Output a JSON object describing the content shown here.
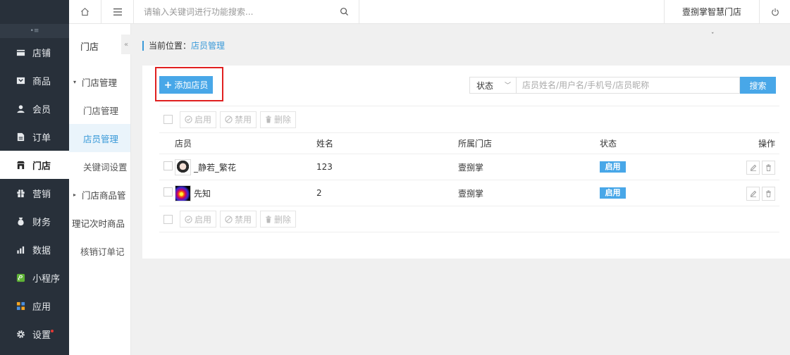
{
  "sidebar": {
    "toggle": "•≡",
    "items": [
      {
        "label": "店铺",
        "icon": "store-icon"
      },
      {
        "label": "商品",
        "icon": "goods-icon"
      },
      {
        "label": "会员",
        "icon": "member-icon"
      },
      {
        "label": "订单",
        "icon": "order-icon"
      },
      {
        "label": "门店",
        "icon": "shop-icon",
        "active": true
      },
      {
        "label": "营销",
        "icon": "gift-icon"
      },
      {
        "label": "财务",
        "icon": "finance-icon"
      },
      {
        "label": "数据",
        "icon": "data-icon"
      },
      {
        "label": "小程序",
        "icon": "miniapp-icon"
      },
      {
        "label": "应用",
        "icon": "apps-icon"
      },
      {
        "label": "设置",
        "icon": "settings-icon"
      }
    ]
  },
  "topbar": {
    "search_placeholder": "请输入关键词进行功能搜索...",
    "store_name": "壹捌掌智慧门店"
  },
  "submenu": {
    "title": "门店",
    "collapse": "«",
    "items": [
      {
        "label": "门店管理",
        "type": "group",
        "caret": "▾"
      },
      {
        "label": "门店管理",
        "type": "child"
      },
      {
        "label": "店员管理",
        "type": "child",
        "active": true
      },
      {
        "label": "关键词设置",
        "type": "child"
      },
      {
        "label": "门店商品管",
        "type": "group",
        "caret": "▸"
      },
      {
        "label": "理记次时商品",
        "type": "plain"
      },
      {
        "label": "核销订单记",
        "type": "child"
      }
    ]
  },
  "breadcrumb": {
    "prefix": "当前位置：",
    "current": "店员管理",
    "chevron": "ˇ"
  },
  "toolbar": {
    "add_icon": "+",
    "add_label": "添加店员",
    "status_select": "状态",
    "status_arrow": "﹀",
    "search_placeholder": "店员姓名/用户名/手机号/店员昵称",
    "search_button": "搜索"
  },
  "bulk": {
    "enable": "启用",
    "disable": "禁用",
    "delete": "删除"
  },
  "table": {
    "headers": [
      "店员",
      "姓名",
      "所属门店",
      "状态",
      "操作"
    ],
    "rows": [
      {
        "nickname": "_静若_繁花",
        "name": "123",
        "store": "壹捌掌",
        "status": "启用"
      },
      {
        "nickname": "先知",
        "name": "2",
        "store": "壹捌掌",
        "status": "启用"
      }
    ]
  },
  "colors": {
    "sidebar_bg": "#28303a",
    "accent": "#48a7e8",
    "highlight": "#e02020"
  }
}
